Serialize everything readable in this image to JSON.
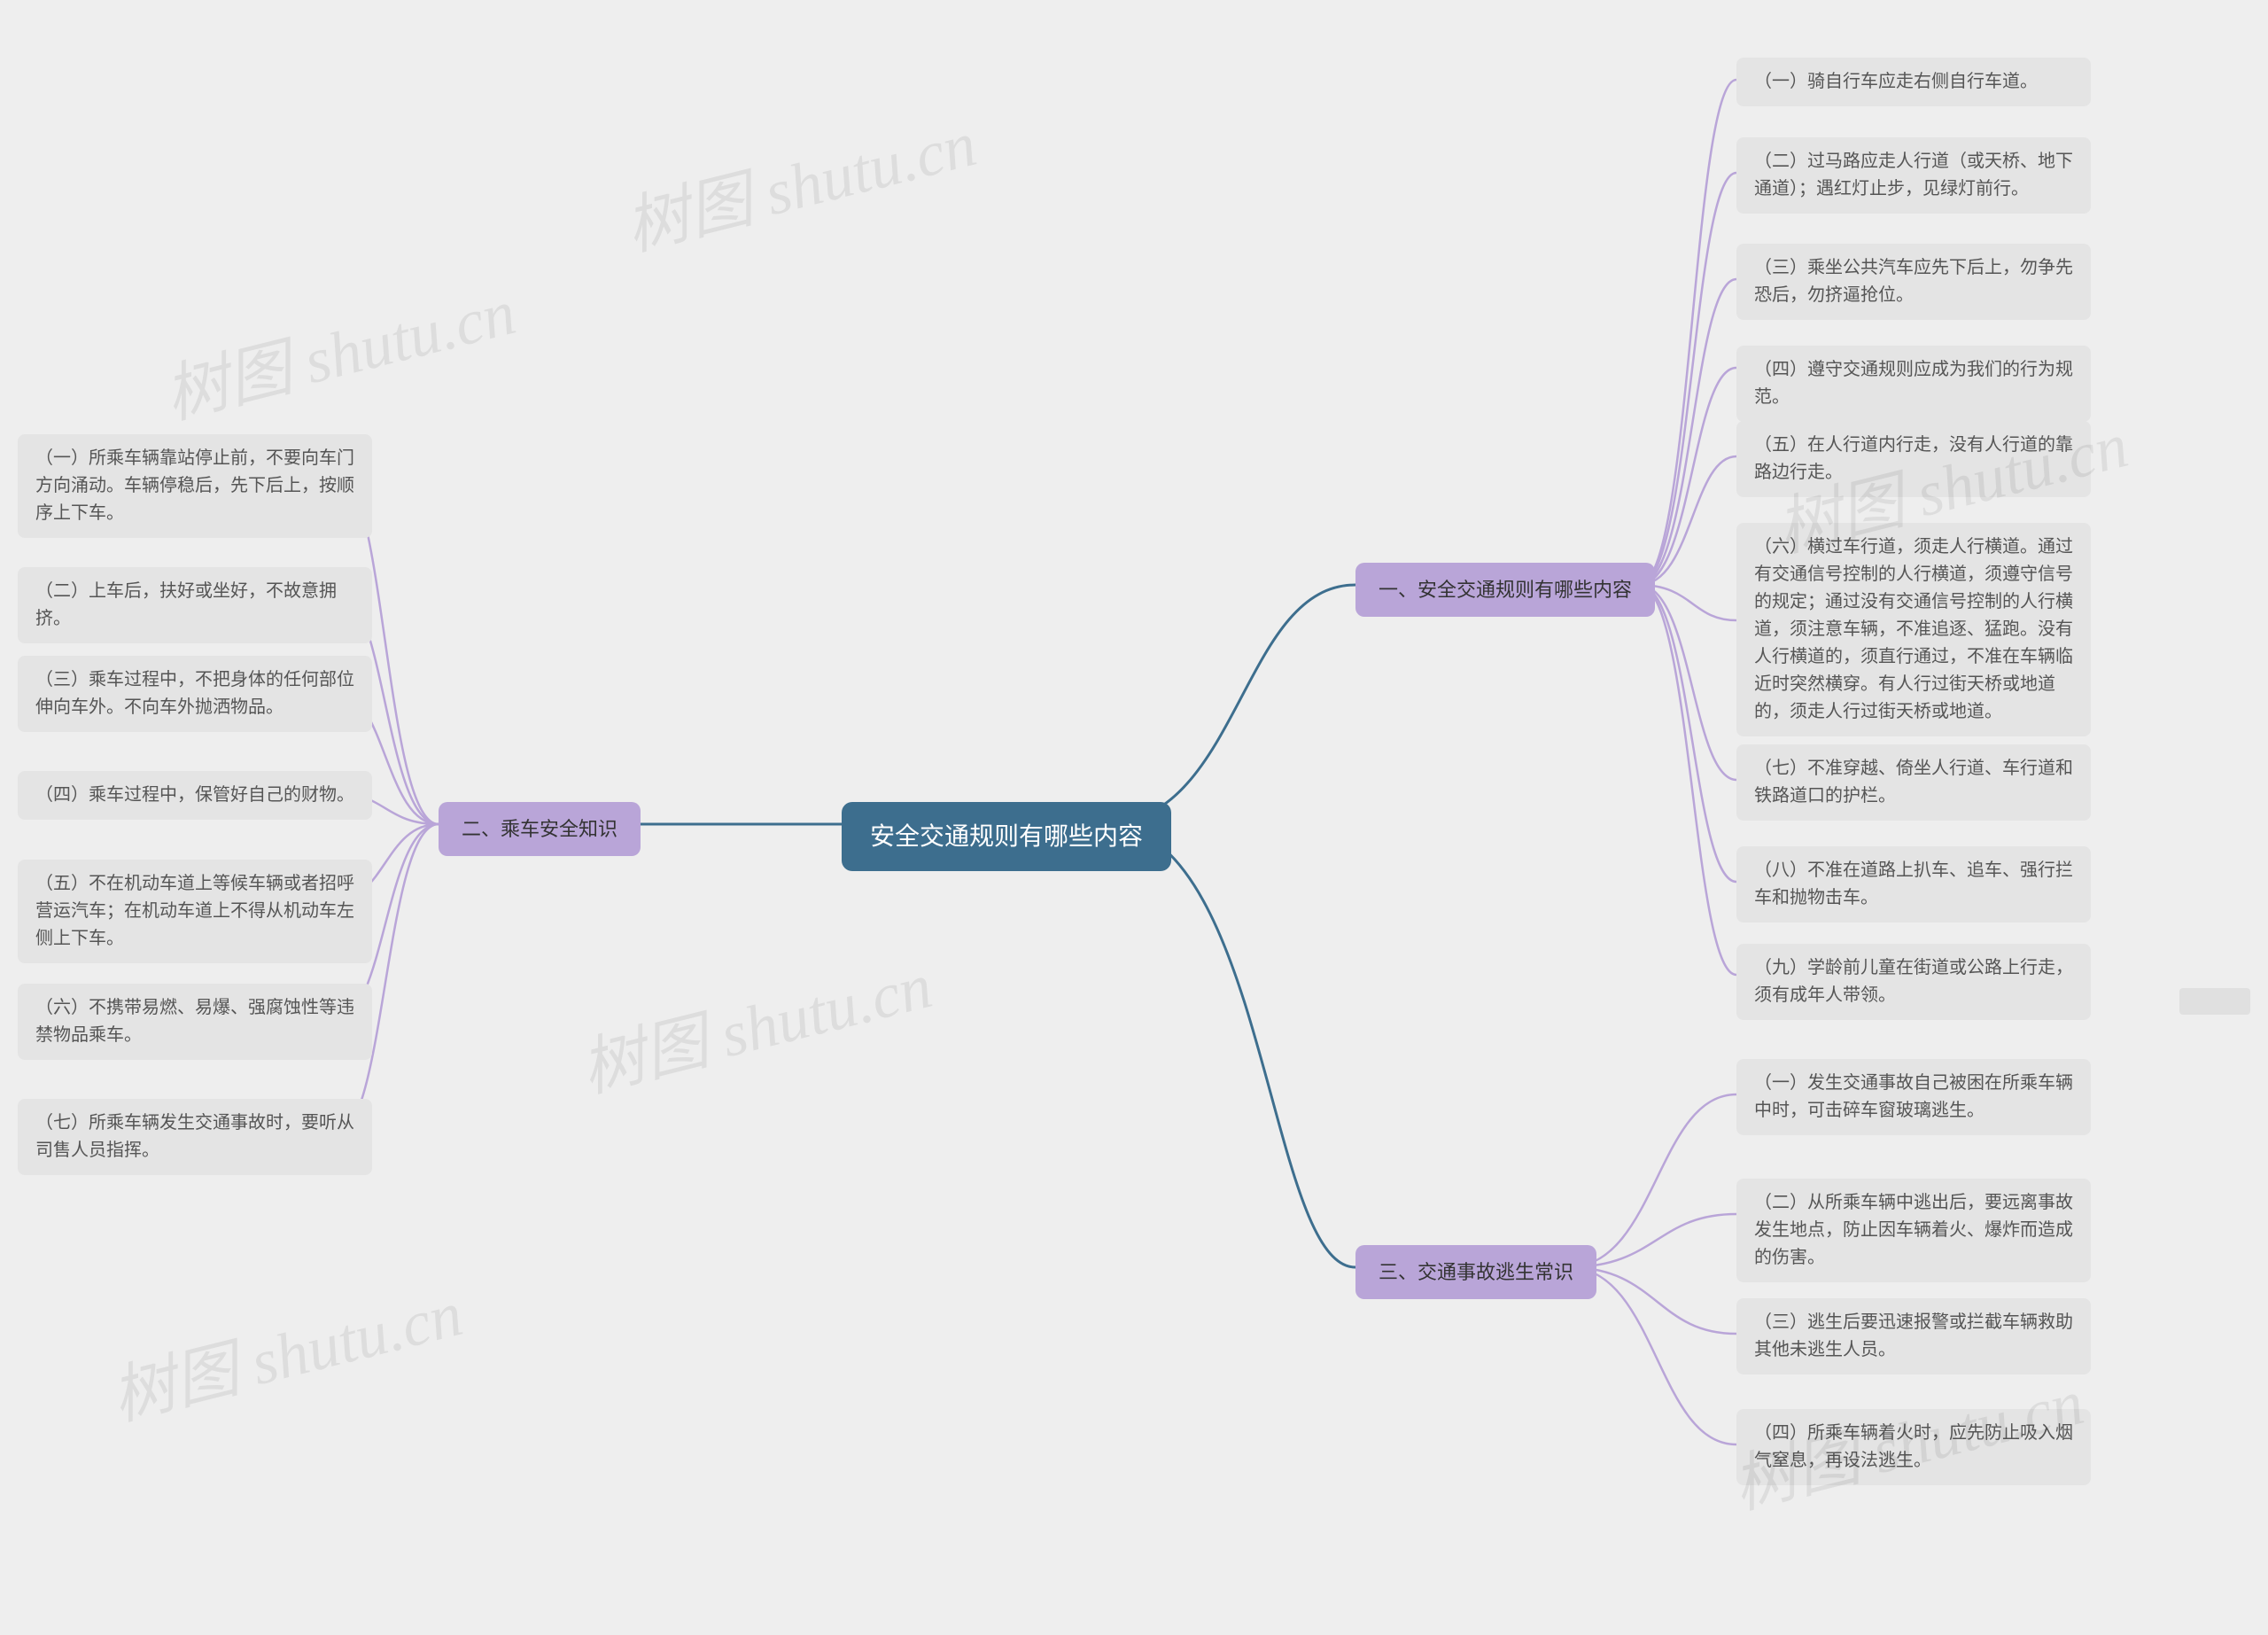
{
  "center": {
    "title": "安全交通规则有哪些内容"
  },
  "branch1": {
    "title": "一、安全交通规则有哪些内容"
  },
  "branch2": {
    "title": "二、乘车安全知识"
  },
  "branch3": {
    "title": "三、交通事故逃生常识"
  },
  "b1": {
    "i1": "（一）骑自行车应走右侧自行车道。",
    "i2": "（二）过马路应走人行道（或天桥、地下通道）；遇红灯止步，见绿灯前行。",
    "i3": "（三）乘坐公共汽车应先下后上，勿争先恐后，勿挤逼抢位。",
    "i4": "（四）遵守交通规则应成为我们的行为规范。",
    "i5": "（五）在人行道内行走，没有人行道的靠路边行走。",
    "i6": "（六）横过车行道，须走人行横道。通过有交通信号控制的人行横道，须遵守信号的规定；通过没有交通信号控制的人行横道，须注意车辆，不准追逐、猛跑。没有人行横道的，须直行通过，不准在车辆临近时突然横穿。有人行过街天桥或地道的，须走人行过街天桥或地道。",
    "i7": "（七）不准穿越、倚坐人行道、车行道和铁路道口的护栏。",
    "i8": "（八）不准在道路上扒车、追车、强行拦车和抛物击车。",
    "i9": "（九）学龄前儿童在街道或公路上行走，须有成年人带领。"
  },
  "b2": {
    "i1": "（一）所乘车辆靠站停止前，不要向车门方向涌动。车辆停稳后，先下后上，按顺序上下车。",
    "i2": "（二）上车后，扶好或坐好，不故意拥挤。",
    "i3": "（三）乘车过程中，不把身体的任何部位伸向车外。不向车外抛洒物品。",
    "i4": "（四）乘车过程中，保管好自己的财物。",
    "i5": "（五）不在机动车道上等候车辆或者招呼营运汽车；在机动车道上不得从机动车左侧上下车。",
    "i6": "（六）不携带易燃、易爆、强腐蚀性等违禁物品乘车。",
    "i7": "（七）所乘车辆发生交通事故时，要听从司售人员指挥。"
  },
  "b3": {
    "i1": "（一）发生交通事故自己被困在所乘车辆中时，可击碎车窗玻璃逃生。",
    "i2": "（二）从所乘车辆中逃出后，要远离事故发生地点，防止因车辆着火、爆炸而造成的伤害。",
    "i3": "（三）逃生后要迅速报警或拦截车辆救助其他未逃生人员。",
    "i4": "（四）所乘车辆着火时，应先防止吸入烟气窒息，再设法逃生。"
  },
  "watermark": "树图 shutu.cn"
}
